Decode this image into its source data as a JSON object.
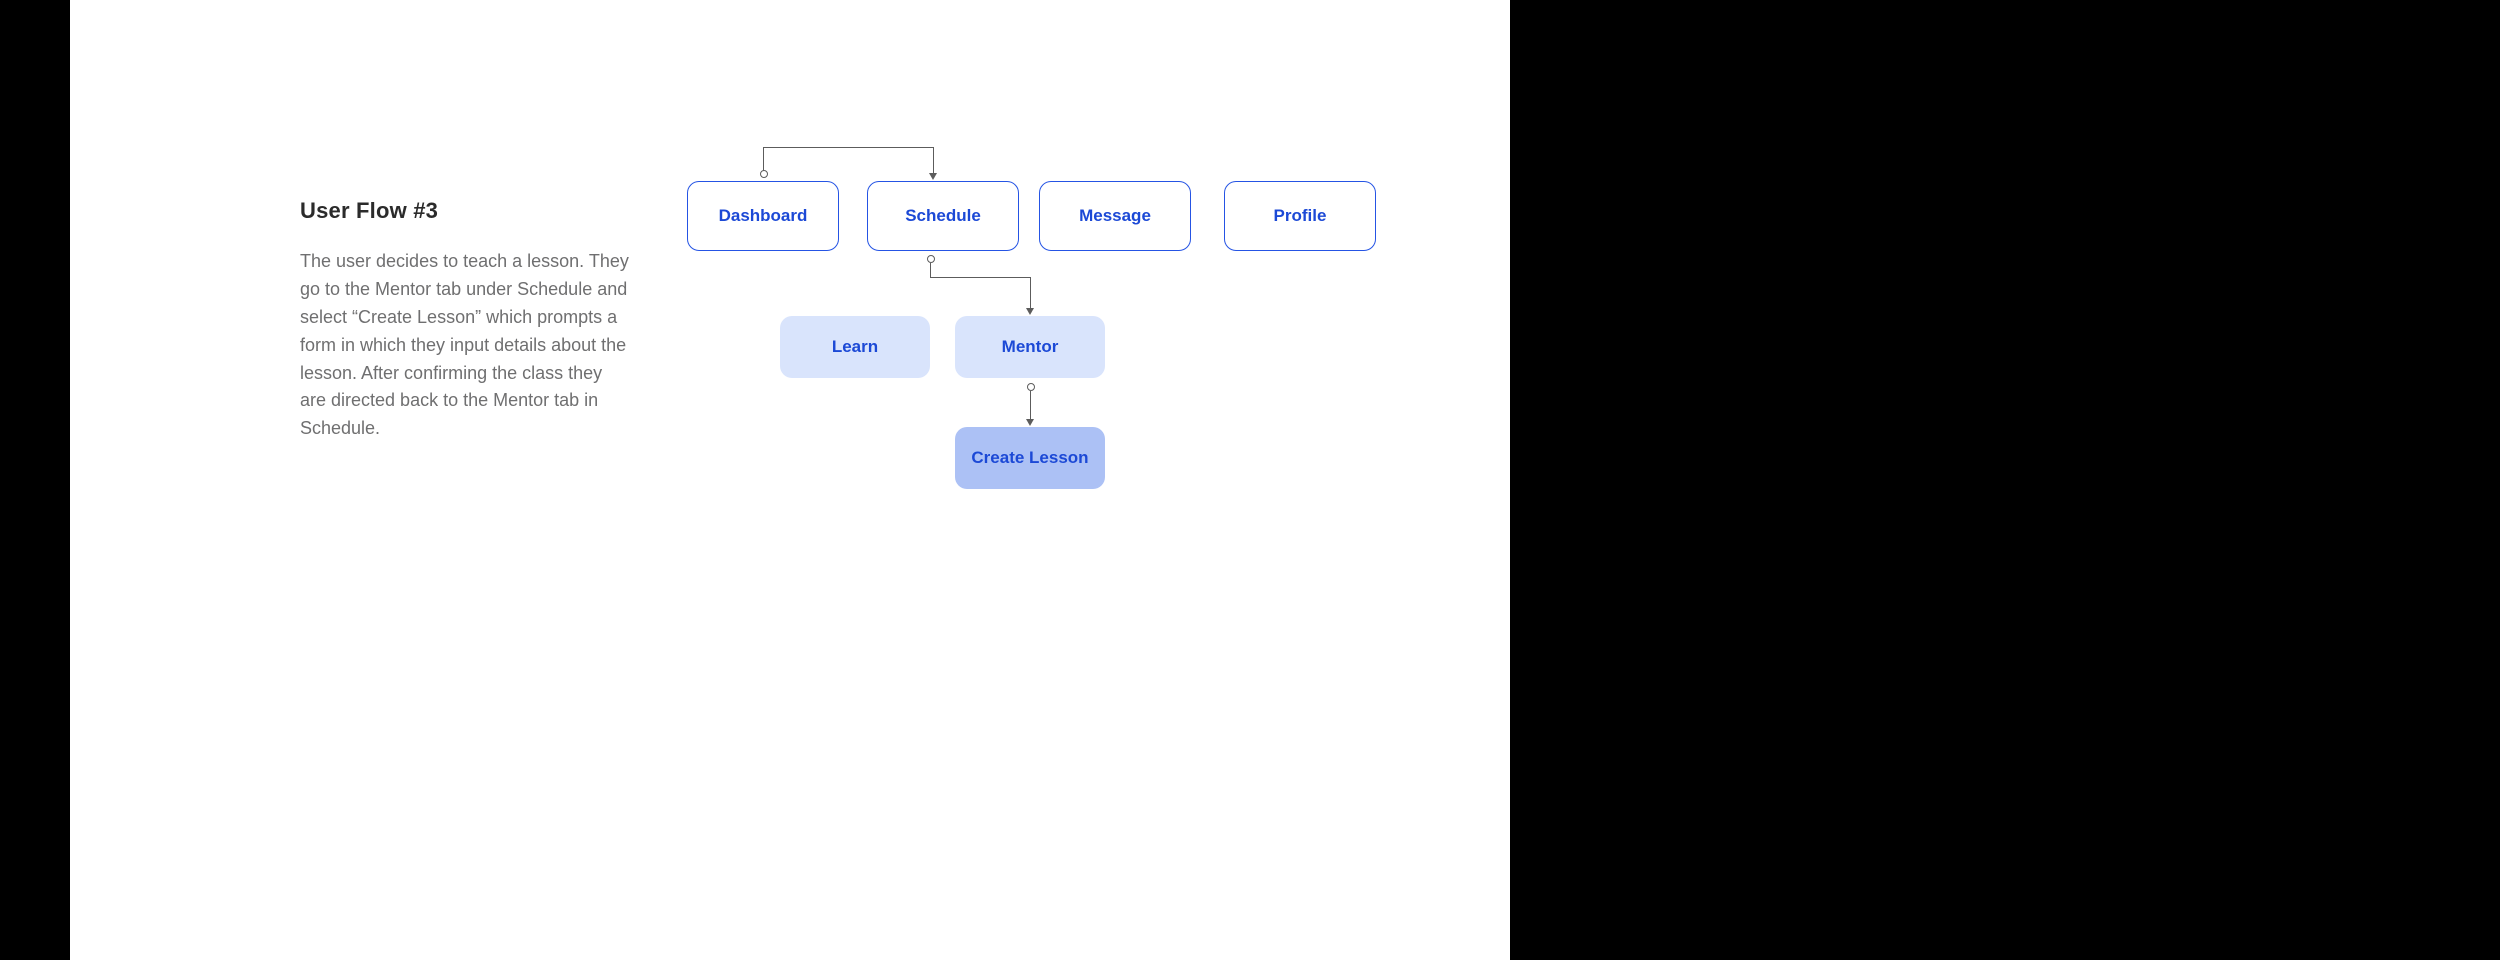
{
  "intro": {
    "title": "User Flow #3",
    "description": "The user decides to teach a lesson. They go to the Mentor tab under Schedule and select “Create Lesson” which prompts a form in which they input details about the lesson. After confirming the class they are directed back to the Mentor tab in Schedule."
  },
  "nodes": {
    "dashboard": "Dashboard",
    "schedule": "Schedule",
    "message": "Message",
    "profile": "Profile",
    "learn": "Learn",
    "mentor": "Mentor",
    "create": "Create Lesson"
  }
}
